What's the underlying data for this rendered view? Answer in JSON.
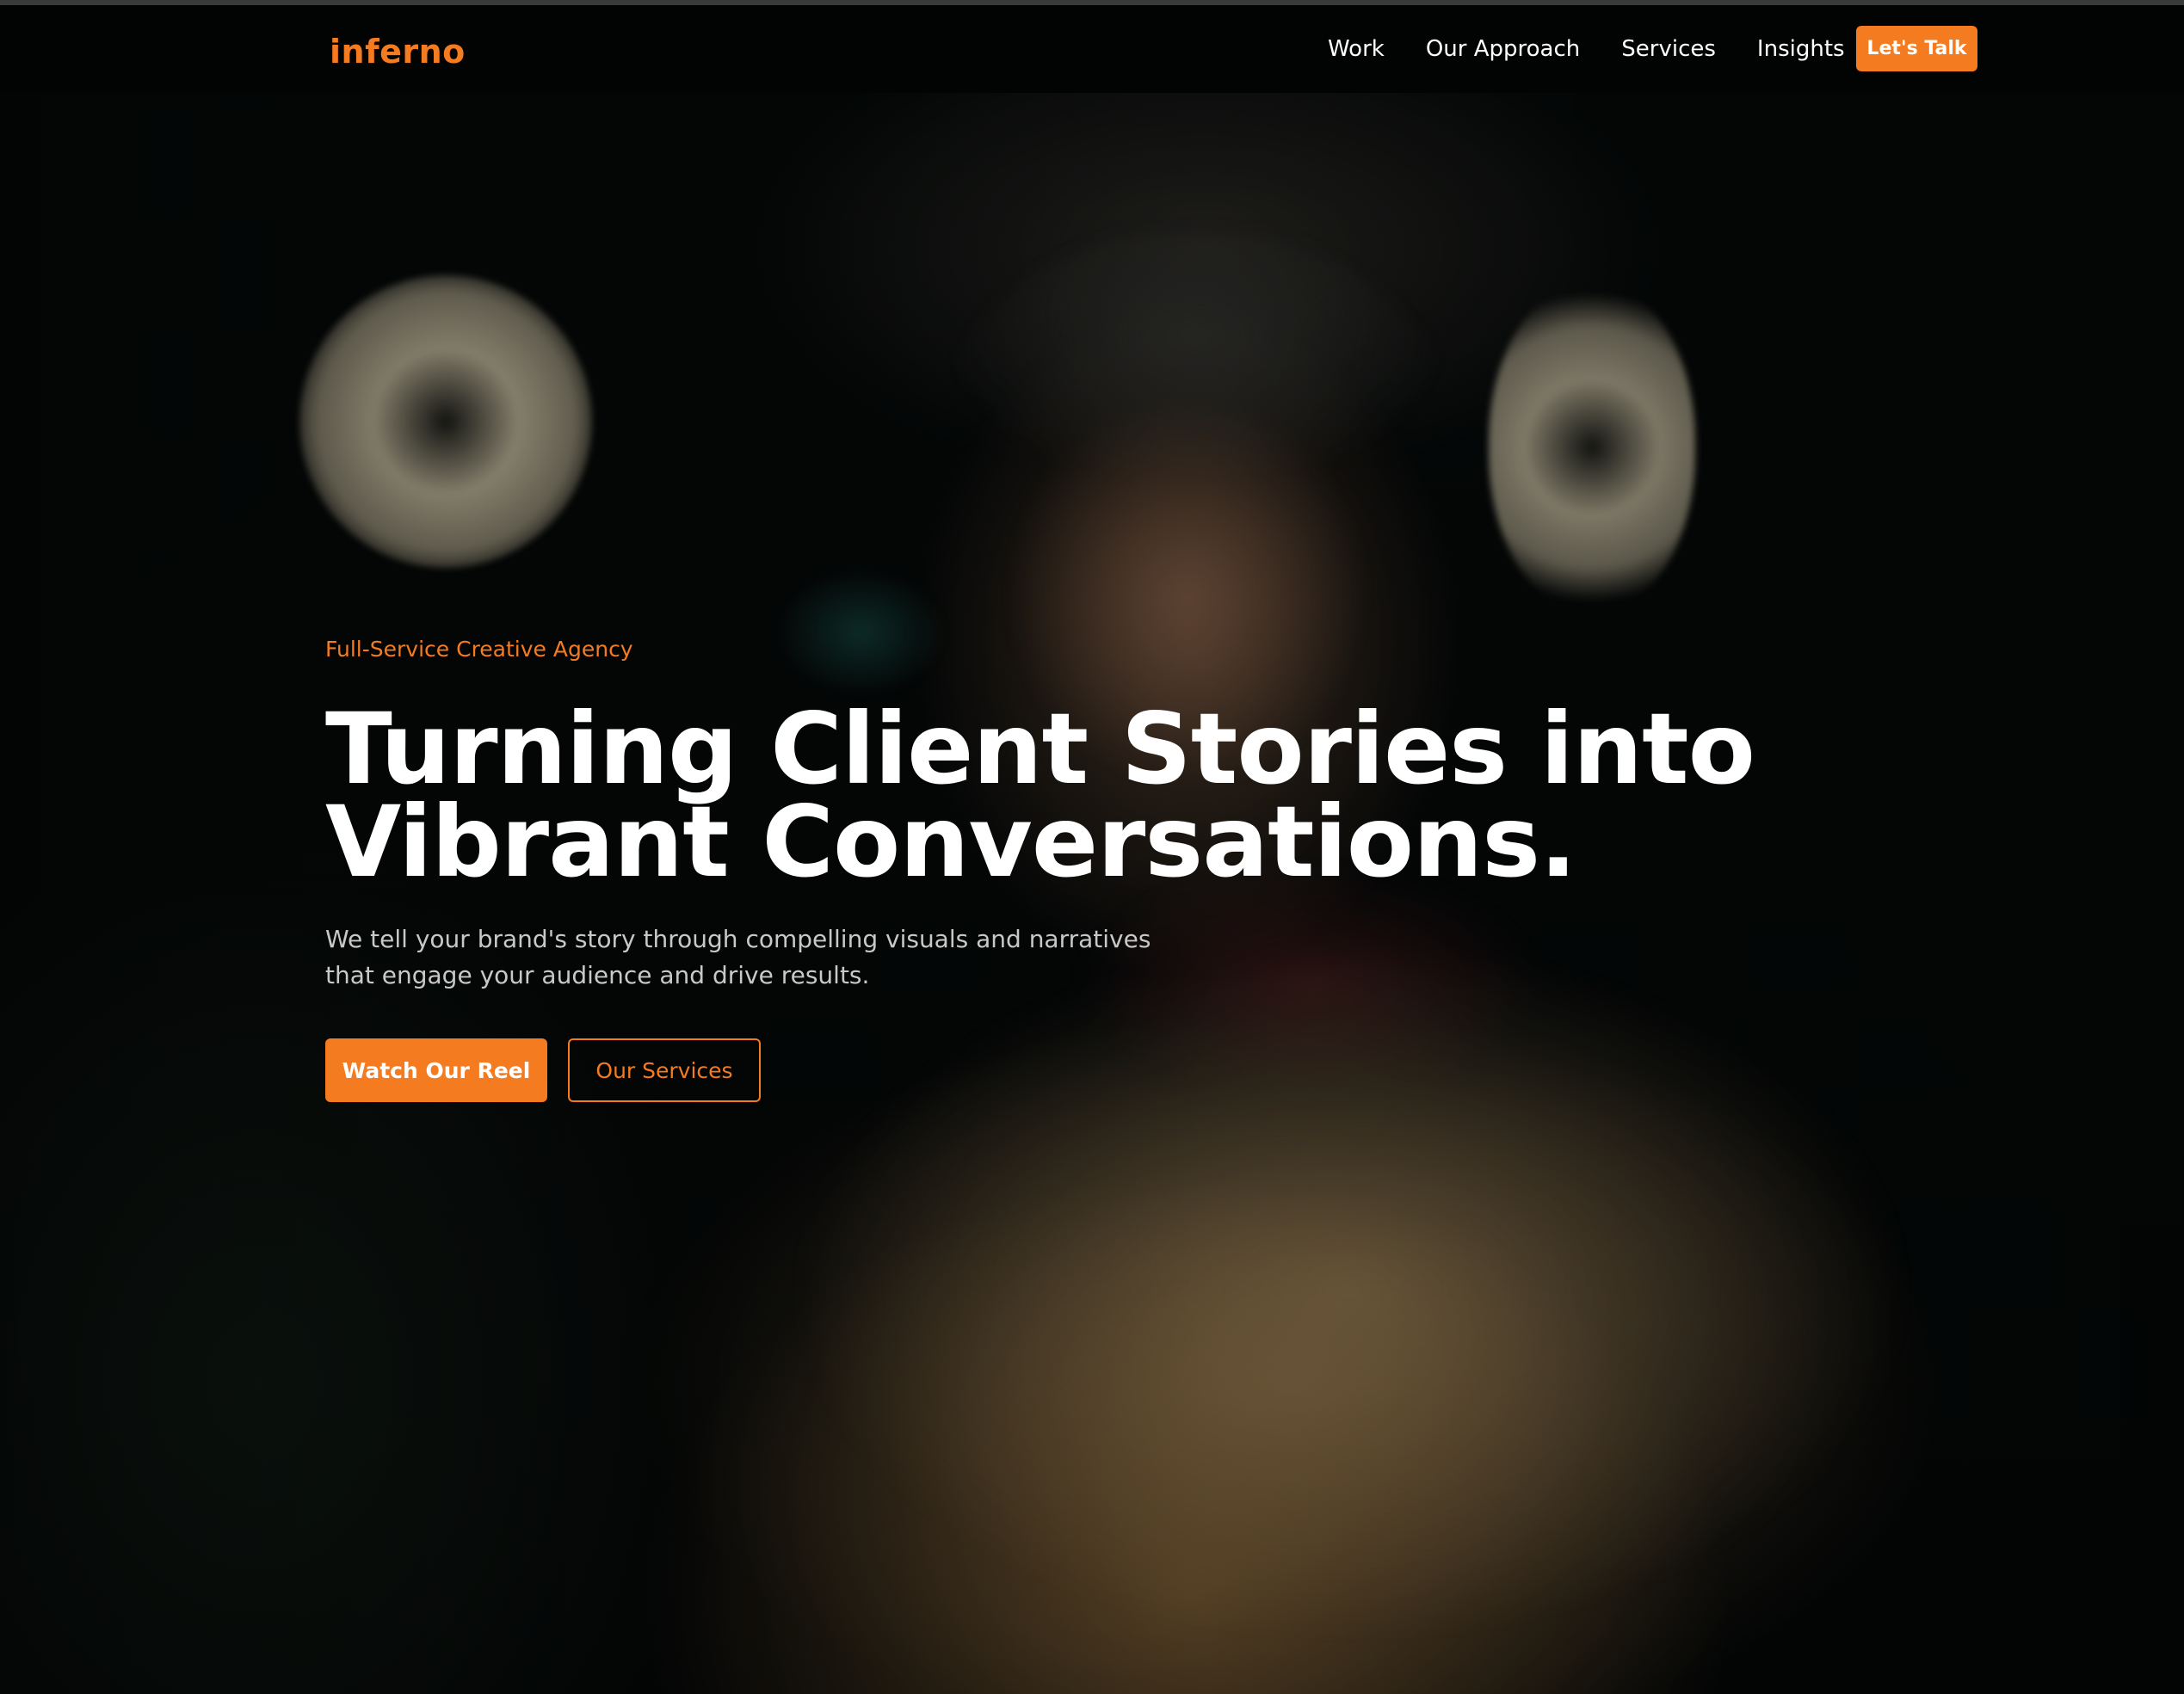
{
  "brand": {
    "logo_text": "inferno",
    "accent_color": "#f47b20"
  },
  "nav": {
    "links": [
      {
        "label": "Work"
      },
      {
        "label": "Our Approach"
      },
      {
        "label": "Services"
      },
      {
        "label": "Insights"
      }
    ],
    "cta_label": "Let's Talk"
  },
  "hero": {
    "eyebrow": "Full-Service Creative Agency",
    "headline": "Turning Client Stories into Vibrant Conversations.",
    "subtext": "We tell your brand's story through compelling visuals and narratives that engage your audience and drive results.",
    "primary_button": "Watch Our Reel",
    "secondary_button": "Our Services"
  }
}
